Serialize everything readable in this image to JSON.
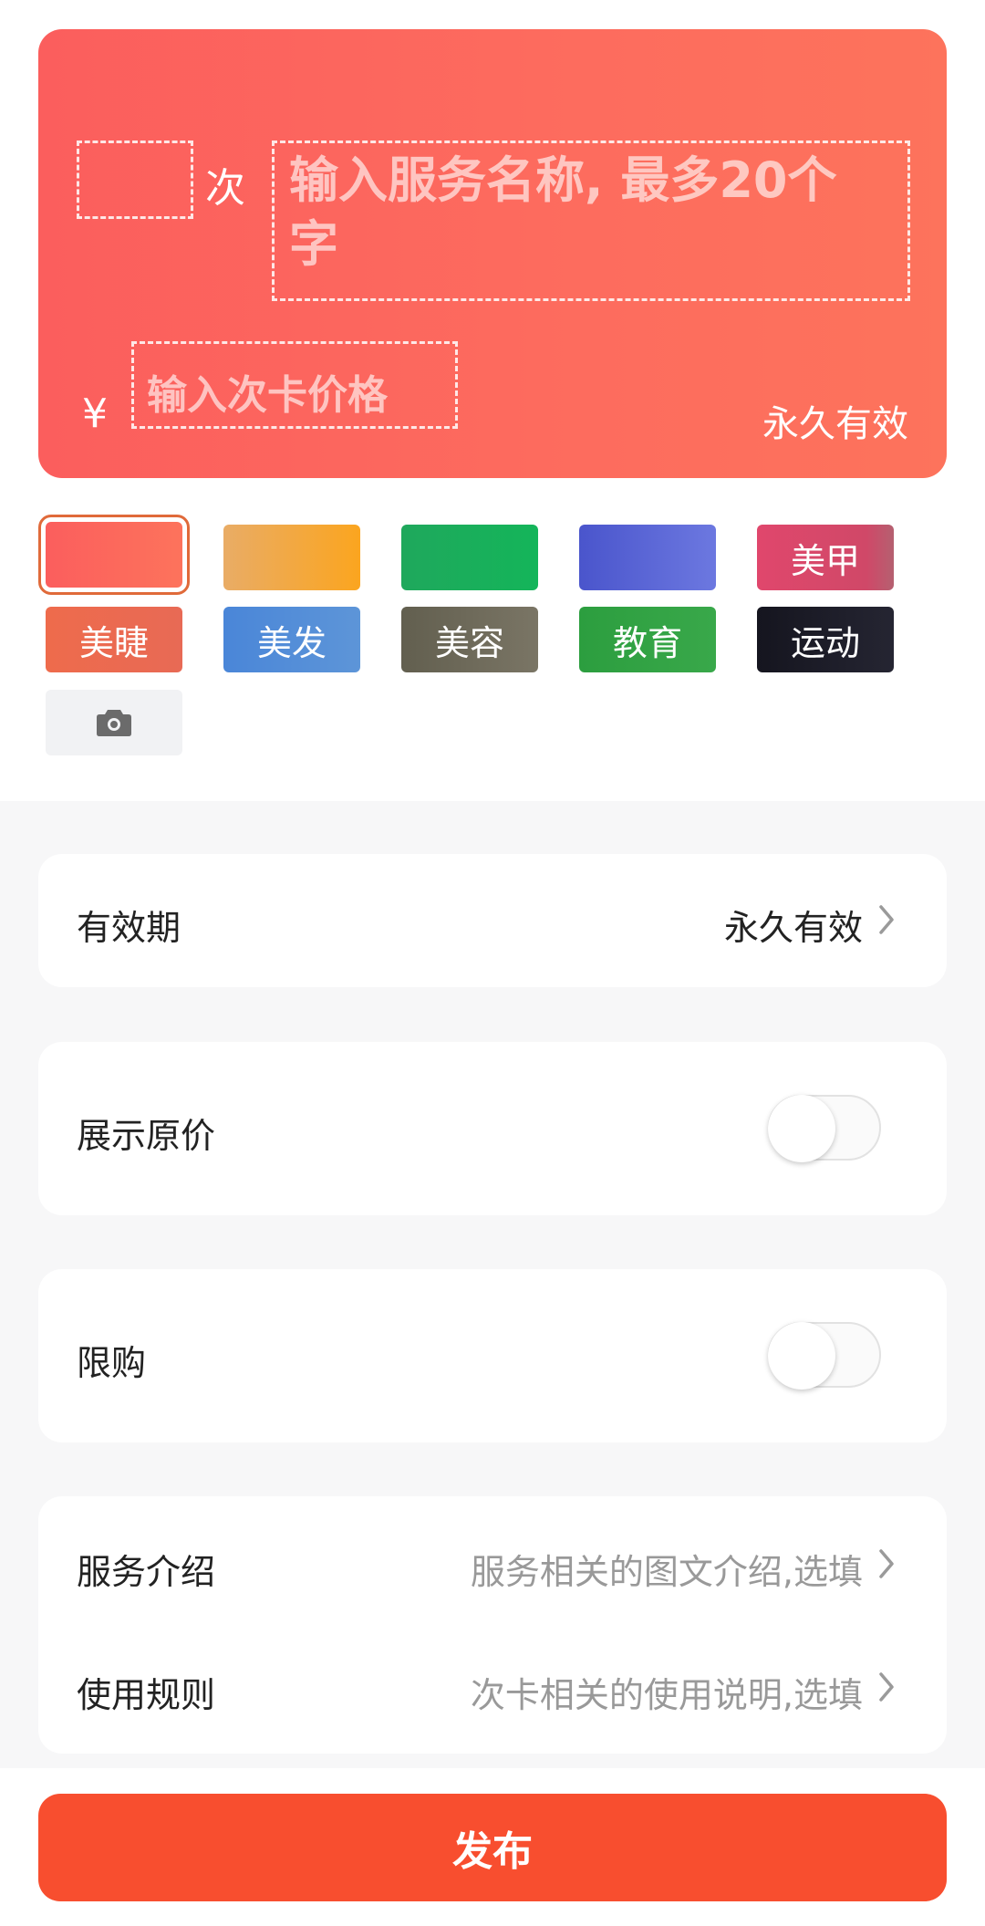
{
  "card": {
    "count_unit": "次",
    "name_placeholder": "输入服务名称, 最多20个字",
    "price_placeholder": "输入次卡价格",
    "currency": "¥",
    "validity": "永久有效"
  },
  "swatches": [
    {
      "label": "",
      "color": "#fb5e5d"
    },
    {
      "label": "",
      "color": "#f5a623"
    },
    {
      "label": "",
      "color": "#1aab5c"
    },
    {
      "label": "",
      "color": "#5862d9"
    },
    {
      "label": "美甲",
      "color": "#e24a6e"
    },
    {
      "label": "美睫",
      "color": "#ef6a4c"
    },
    {
      "label": "美发",
      "color": "#4f8ad6"
    },
    {
      "label": "美容",
      "color": "#6d6a5a"
    },
    {
      "label": "教育",
      "color": "#2fa243"
    },
    {
      "label": "运动",
      "color": "#1a1a26"
    }
  ],
  "settings": {
    "validity": {
      "label": "有效期",
      "value": "永久有效"
    },
    "show_original_price": {
      "label": "展示原价",
      "enabled": false
    },
    "purchase_limit": {
      "label": "限购",
      "enabled": false
    },
    "service_intro": {
      "label": "服务介绍",
      "placeholder": "服务相关的图文介绍,选填"
    },
    "usage_rules": {
      "label": "使用规则",
      "placeholder": "次卡相关的使用说明,选填"
    }
  },
  "publish_label": "发布",
  "colors": {
    "accent": "#f84e2f",
    "placeholder": "#999999"
  }
}
